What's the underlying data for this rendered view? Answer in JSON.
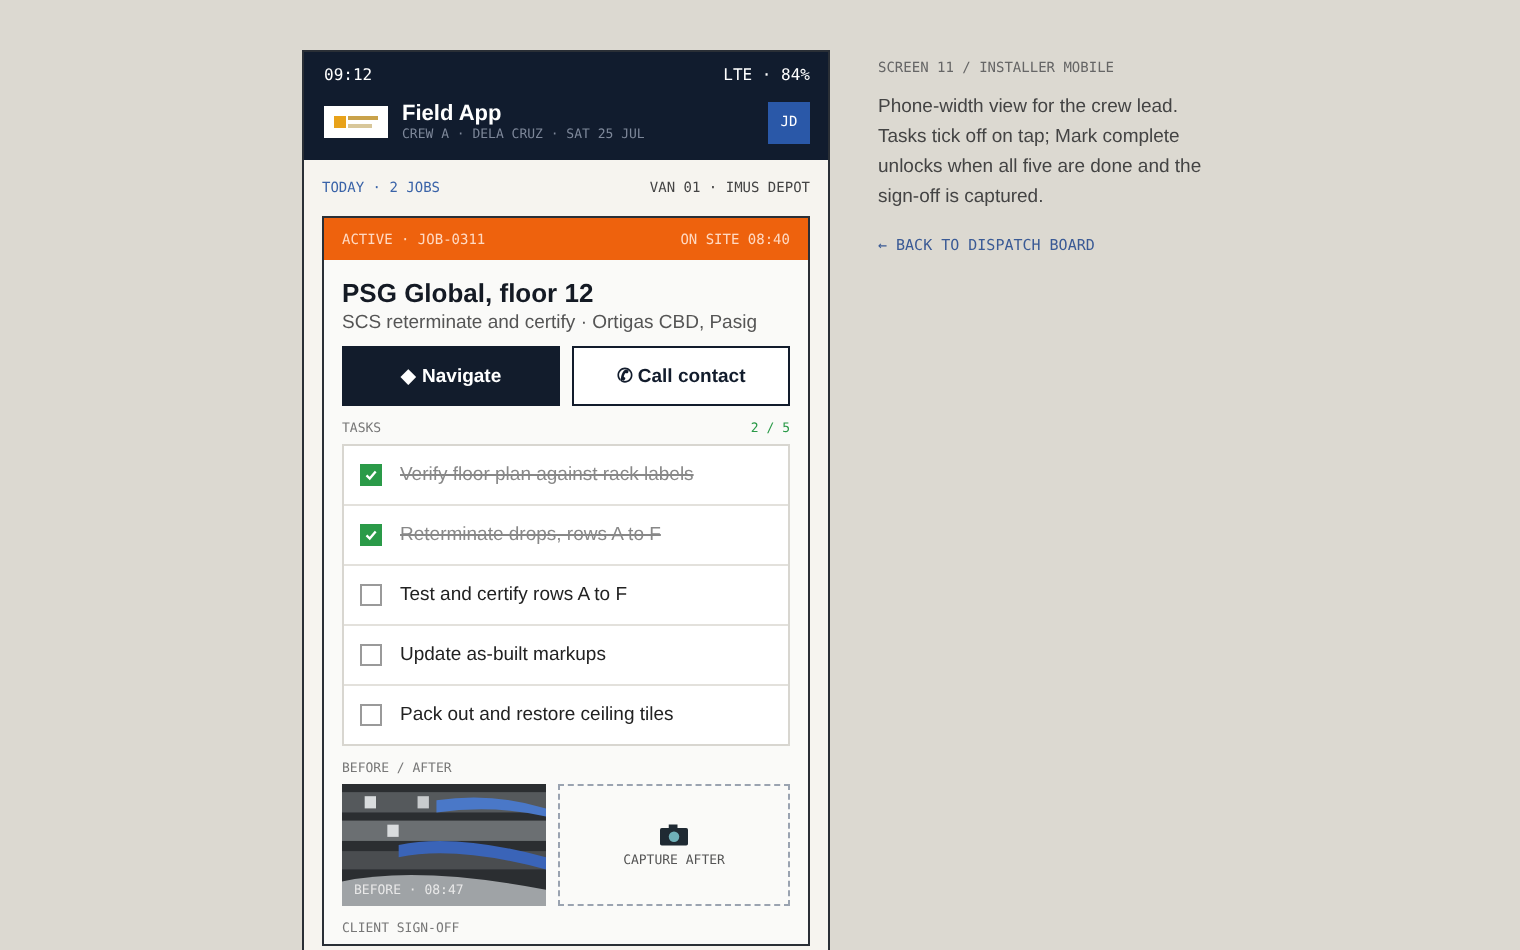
{
  "status_bar": {
    "time": "09:12",
    "signal": "LTE · 84%"
  },
  "header": {
    "title": "Field App",
    "subtitle": "CREW A · DELA CRUZ · SAT 25 JUL",
    "avatar": "JD"
  },
  "summary": {
    "left": "TODAY · 2 JOBS",
    "right": "VAN 01 · IMUS DEPOT"
  },
  "job": {
    "status": "ACTIVE · JOB-0311",
    "on_site": "ON SITE 08:40",
    "title": "PSG Global, floor 12",
    "subtitle": "SCS reterminate and certify · Ortigas CBD, Pasig",
    "buttons": [
      {
        "label": "◆ Navigate",
        "kind": "primary"
      },
      {
        "label": "✆ Call contact",
        "kind": "secondary"
      }
    ],
    "tasks_label": "TASKS",
    "tasks_count": "2 / 5",
    "tasks": [
      {
        "label": "Verify floor plan against rack labels",
        "checked": true
      },
      {
        "label": "Reterminate drops, rows A to F",
        "checked": true
      },
      {
        "label": "Test and certify rows A to F",
        "checked": false
      },
      {
        "label": "Update as-built markups",
        "checked": false
      },
      {
        "label": "Pack out and restore ceiling tiles",
        "checked": false
      }
    ],
    "photos_label": "BEFORE / AFTER",
    "before_caption": "BEFORE · 08:47",
    "capture_label": "CAPTURE AFTER",
    "signoff_label": "CLIENT SIGN-OFF"
  },
  "aside": {
    "eyebrow": "SCREEN 11 / INSTALLER MOBILE",
    "text": "Phone-width view for the crew lead. Tasks tick off on tap; Mark complete unlocks when all five are done and the sign-off is captured.",
    "link": "← BACK TO DISPATCH BOARD"
  }
}
